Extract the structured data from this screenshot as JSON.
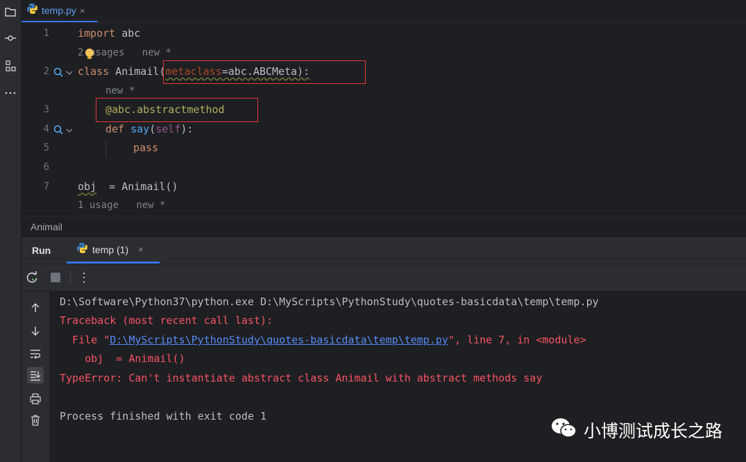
{
  "editor_tab": {
    "filename": "temp.py",
    "close": "×",
    "icon": "python-icon"
  },
  "toolstrip": {
    "icons": [
      "project-folder-icon",
      "commit-icon",
      "structure-icon",
      "more-icon"
    ]
  },
  "code": {
    "lines": [
      {
        "num": "1",
        "text": "import abc"
      },
      {
        "num": "2",
        "text": "class Animail(metaclass=abc.ABCMeta):"
      },
      {
        "num": "3",
        "text": "@abc.abstractmethod"
      },
      {
        "num": "4",
        "text": "def say(self):"
      },
      {
        "num": "5",
        "text": "pass"
      },
      {
        "num": "6",
        "text": ""
      },
      {
        "num": "7",
        "text": "obj  = Animail()"
      }
    ],
    "tokens": {
      "import": "import",
      "abc": " abc",
      "class": "class",
      "classname": " Animail(",
      "metaclass": "metaclass",
      "meta_rest": "=abc.ABCMeta):",
      "decorator": "@abc.abstractmethod",
      "def": "def",
      "say": " say",
      "open": "(",
      "self": "self",
      "close": "):",
      "pass": "pass",
      "obj": "obj",
      "obj_rest": "  = Animail()"
    },
    "hints": {
      "usages_2": "2 usages",
      "new_2": "new *",
      "new_3": "new *",
      "usages_7": "1 usage",
      "new_7": "new *"
    }
  },
  "breadcrumb": "Animail",
  "run_panel": {
    "title": "Run",
    "tab_label": "temp (1)",
    "tab_close": "×",
    "more": "⋮"
  },
  "console": {
    "lines": [
      "D:\\Software\\Python37\\python.exe D:\\MyScripts\\PythonStudy\\quotes-basicdata\\temp\\temp.py",
      "Traceback (most recent call last):",
      "  File \"",
      "D:\\MyScripts\\PythonStudy\\quotes-basicdata\\temp\\temp.py",
      "\", line 7, in <module>",
      "    obj  = Animail()",
      "TypeError: Can't instantiate abstract class Animail with abstract methods say",
      "Process finished with exit code 1"
    ]
  },
  "watermark": "小博测试成长之路",
  "colors": {
    "accent": "#3574f0",
    "error": "#f75464",
    "link": "#548af7",
    "highlight_box": "#e53935"
  }
}
